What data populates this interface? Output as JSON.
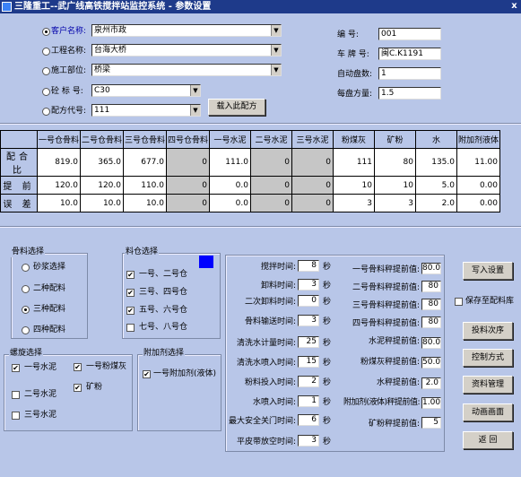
{
  "window": {
    "title": "三隆重工--武广线高铁搅拌站监控系统 - 参数设置",
    "close": "x"
  },
  "top_left": {
    "customer_label": "客户名称:",
    "customer_value": "泉州市政",
    "project_label": "工程名称:",
    "project_value": "台海大桥",
    "part_label": "施工部位:",
    "part_value": "桥梁",
    "grade_label": "砼 标 号:",
    "grade_value": "C30",
    "recipe_label": "配方代号:",
    "recipe_value": "111",
    "load_button": "载入此配方"
  },
  "top_right": {
    "number_label": "编  号:",
    "number_value": "001",
    "plate_label": "车 牌 号:",
    "plate_value": "闽C.K1191",
    "auto_label": "自动盘数:",
    "auto_value": "1",
    "volume_label": "每盘方量:",
    "volume_value": "1.5"
  },
  "table": {
    "columns": [
      "一号仓骨料",
      "二号仓骨料",
      "三号仓骨料",
      "四号仓骨料",
      "一号水泥",
      "二号水泥",
      "三号水泥",
      "粉煤灰",
      "矿粉",
      "水",
      "附加剂液体"
    ],
    "rows": [
      {
        "label": "配合比",
        "values": [
          "819.0",
          "365.0",
          "677.0",
          "0",
          "111.0",
          "0",
          "0",
          "111",
          "80",
          "135.0",
          "11.00"
        ]
      },
      {
        "label": "提 前",
        "values": [
          "120.0",
          "120.0",
          "110.0",
          "0",
          "0.0",
          "0",
          "0",
          "10",
          "10",
          "5.0",
          "0.00"
        ]
      },
      {
        "label": "误 差",
        "values": [
          "10.0",
          "10.0",
          "10.0",
          "0",
          "0.0",
          "0",
          "0",
          "3",
          "3",
          "2.0",
          "0.00"
        ]
      }
    ]
  },
  "aggregate_group": {
    "title": "骨料选择",
    "options": [
      "砂浆选择",
      "二种配料",
      "三种配料",
      "四种配料"
    ],
    "selected": "三种配料"
  },
  "bin_group": {
    "title": "料仓选择",
    "items": [
      {
        "label": "一号、二号仓",
        "checked": true
      },
      {
        "label": "三号、四号仓",
        "checked": true
      },
      {
        "label": "五号、六号仓",
        "checked": true
      },
      {
        "label": "七号、八号仓",
        "checked": false
      }
    ],
    "indicator_color": "#0000ff"
  },
  "screw_group": {
    "title": "螺旋选择",
    "items": [
      {
        "label": "一号水泥",
        "checked": true
      },
      {
        "label": "一号粉煤灰",
        "checked": true
      },
      {
        "label": "二号水泥",
        "checked": false
      },
      {
        "label": "矿粉",
        "checked": true
      },
      {
        "label": "三号水泥",
        "checked": false
      }
    ]
  },
  "additive_group": {
    "title": "附加剂选择",
    "items": [
      {
        "label": "一号附加剂(液体)",
        "checked": true
      }
    ]
  },
  "times": {
    "unit": "秒",
    "items": [
      {
        "label": "搅拌时间:",
        "value": "8"
      },
      {
        "label": "卸料时间:",
        "value": "3"
      },
      {
        "label": "二次卸料时间:",
        "value": "0"
      },
      {
        "label": "骨料输送时间:",
        "value": "3"
      },
      {
        "label": "清洗水计量时间:",
        "value": "25"
      },
      {
        "label": "清洗水喷入时间:",
        "value": "15"
      },
      {
        "label": "粉料投入时间:",
        "value": "2"
      },
      {
        "label": "水喷入时间:",
        "value": "1"
      },
      {
        "label": "最大安全关门时间:",
        "value": "6"
      },
      {
        "label": "平皮带放空时间:",
        "value": "3"
      }
    ]
  },
  "advances": {
    "items": [
      {
        "label": "一号骨料秤提前值:",
        "value": "80.0"
      },
      {
        "label": "二号骨料秤提前值:",
        "value": "80"
      },
      {
        "label": "三号骨料秤提前值:",
        "value": "80"
      },
      {
        "label": "四号骨料秤提前值:",
        "value": "80"
      },
      {
        "label": "水泥秤提前值:",
        "value": "80.0"
      },
      {
        "label": "粉煤灰秤提前值:",
        "value": "50.0"
      },
      {
        "label": "水秤提前值:",
        "value": "2.0"
      },
      {
        "label": "附加剂(液体)秤提前值:",
        "value": "1.00"
      },
      {
        "label": "矿粉秤提前值:",
        "value": "5"
      }
    ]
  },
  "side_buttons": {
    "write": "写入设置",
    "save_checkbox": "保存至配料库",
    "save_checked": false,
    "feed_order": "投料次序",
    "control_mode": "控制方式",
    "data_mgmt": "资料管理",
    "anim": "动画画面",
    "back": "返  回"
  }
}
